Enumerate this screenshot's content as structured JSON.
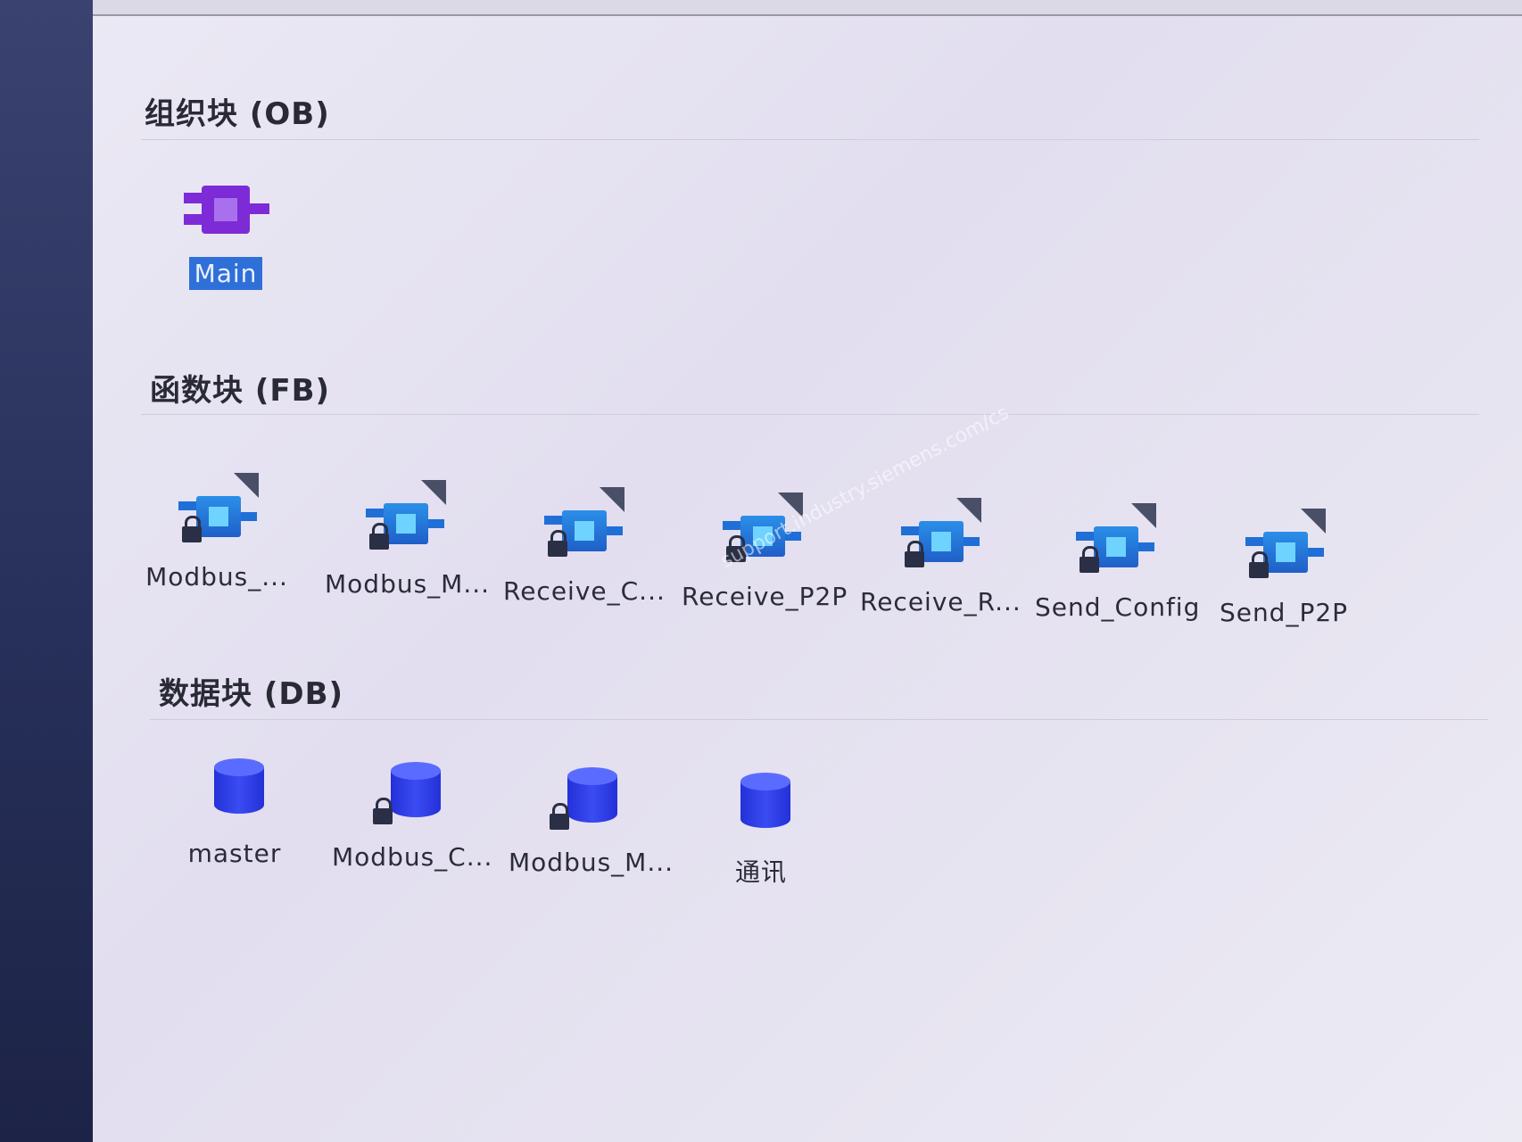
{
  "sections": {
    "ob": {
      "title": "组织块 (OB)"
    },
    "fb": {
      "title": "函数块 (FB)"
    },
    "db": {
      "title": "数据块 (DB)"
    }
  },
  "ob_blocks": [
    {
      "label": "Main",
      "selected": true,
      "icon": "organization-block-icon"
    }
  ],
  "fb_blocks": [
    {
      "label": "Modbus_...",
      "icon": "function-block-locked-icon"
    },
    {
      "label": "Modbus_M...",
      "icon": "function-block-locked-icon"
    },
    {
      "label": "Receive_C...",
      "icon": "function-block-locked-icon"
    },
    {
      "label": "Receive_P2P",
      "icon": "function-block-locked-icon"
    },
    {
      "label": "Receive_R...",
      "icon": "function-block-locked-icon"
    },
    {
      "label": "Send_Config",
      "icon": "function-block-locked-icon"
    },
    {
      "label": "Send_P2P",
      "icon": "function-block-locked-icon"
    }
  ],
  "db_blocks": [
    {
      "label": "master",
      "locked": false,
      "icon": "data-block-icon"
    },
    {
      "label": "Modbus_C...",
      "locked": true,
      "icon": "data-block-locked-icon"
    },
    {
      "label": "Modbus_M...",
      "locked": true,
      "icon": "data-block-locked-icon"
    },
    {
      "label": "通讯",
      "locked": false,
      "icon": "data-block-icon"
    }
  ],
  "watermark": "support.industry.siemens.com/cs",
  "colors": {
    "selection": "#2f6fd8",
    "ob_purple": "#7d2bd6",
    "fb_blue": "#1f5fc8",
    "db_blue": "#2430d8"
  }
}
